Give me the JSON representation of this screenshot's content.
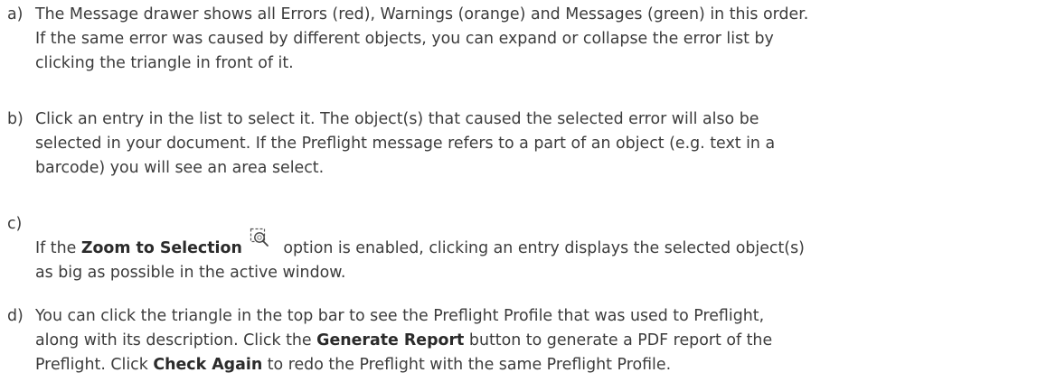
{
  "items": [
    {
      "marker": "a)",
      "lines": [
        "The Message drawer shows all Errors (red), Warnings (orange) and Messages (green) in this order.",
        "If the same error was caused by different objects, you can expand or collapse the error list by",
        "clicking the triangle in front of it."
      ]
    },
    {
      "marker": "b)",
      "lines": [
        "Click an entry in the list to select it. The object(s) that caused the selected error will also be",
        "selected in your document. If the Preflight message refers to a part of an object (e.g. text in a",
        "barcode) you will see an area select."
      ]
    },
    {
      "marker": "c)",
      "line1_pre": "If the ",
      "line1_bold": "Zoom to Selection",
      "line1_post": " option is enabled, clicking an entry displays the selected object(s)",
      "line2": "as big as possible in the active window."
    },
    {
      "marker": "d)",
      "line1": "You can click the triangle in the top bar to see the Preflight Profile that was used to Preflight,",
      "line2_pre": "along with its description. Click the ",
      "line2_bold": "Generate Report",
      "line2_post": " button to generate a PDF report of the",
      "line3_pre": "Preflight. Click ",
      "line3_bold": "Check Again",
      "line3_post": " to redo the Preflight with the same Preflight Profile."
    }
  ],
  "icons": {
    "zoom_to_selection": "zoom-to-selection-icon"
  }
}
